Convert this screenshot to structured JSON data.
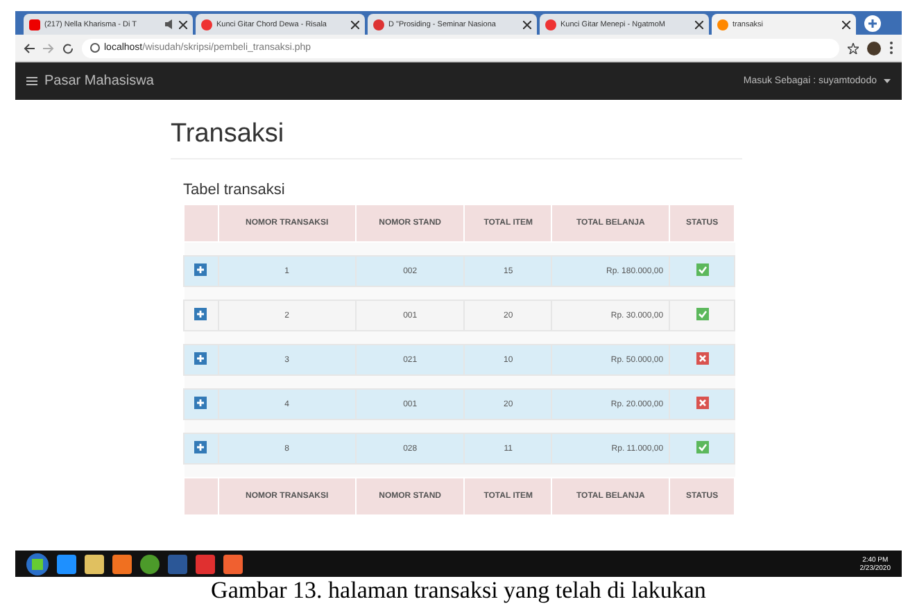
{
  "browser": {
    "tabs": [
      {
        "label": "(217) Nella Kharisma - Di T",
        "selected": false,
        "audio": true,
        "kind": "video"
      },
      {
        "label": "Kunci Gitar Chord Dewa - Risala",
        "selected": false,
        "audio": false,
        "kind": "music"
      },
      {
        "label": "D \"Prosiding - Seminar Nasiona",
        "selected": false,
        "audio": false,
        "kind": "mail"
      },
      {
        "label": "Kunci Gitar Menepi - NgatmoM",
        "selected": false,
        "audio": false,
        "kind": "music"
      },
      {
        "label": "transaksi",
        "selected": true,
        "audio": false,
        "kind": "local"
      }
    ],
    "url_host": "localhost",
    "url_path": "/wisudah/skripsi/pembeli_transaksi.php"
  },
  "navbar": {
    "brand": "Pasar Mahasiswa",
    "user": "Masuk Sebagai : suyamtododo"
  },
  "page_title": "Transaksi",
  "table": {
    "title": "Tabel transaksi",
    "columns": [
      "NOMOR TRANSAKSI",
      "NOMOR STAND",
      "TOTAL ITEM",
      "TOTAL BELANJA",
      "STATUS"
    ],
    "rows": [
      {
        "cells": [
          "1",
          "002",
          "15",
          "Rp. 180.000,00"
        ],
        "checked": true,
        "color": "#d9edf7"
      },
      {
        "cells": [
          "2",
          "001",
          "20",
          "Rp. 30.000,00"
        ],
        "checked": true,
        "color": "#f5f5f5"
      },
      {
        "cells": [
          "3",
          "021",
          "10",
          "Rp. 50.000,00"
        ],
        "checked": false,
        "color": "#d9edf7"
      },
      {
        "cells": [
          "4",
          "001",
          "20",
          "Rp. 20.000,00"
        ],
        "checked": false,
        "color": "#d9edf7"
      },
      {
        "cells": [
          "8",
          "028",
          "11",
          "Rp. 11.000,00"
        ],
        "checked": true,
        "color": "#d9edf7"
      }
    ],
    "footer_columns": [
      "NOMOR TRANSAKSI",
      "NOMOR STAND",
      "TOTAL ITEM",
      "TOTAL BELANJA",
      "STATUS"
    ]
  },
  "taskbar": {
    "time": "2:40 PM",
    "date": "2/23/2020"
  },
  "caption": "Gambar 13. halaman transaksi yang telah di lakukan"
}
